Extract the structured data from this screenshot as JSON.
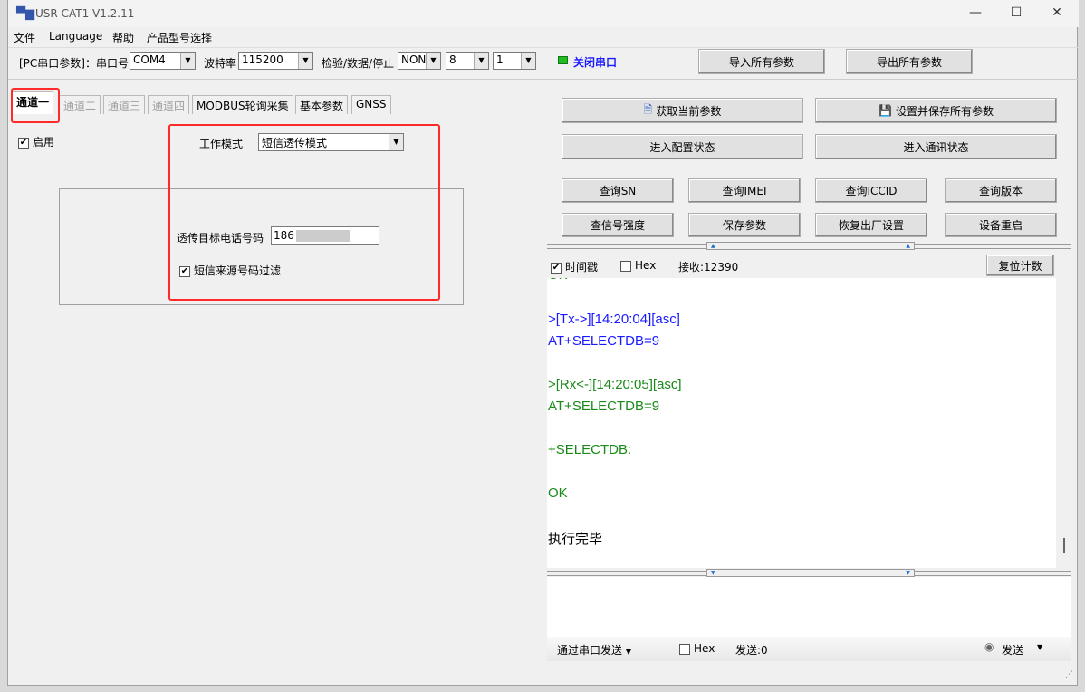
{
  "window": {
    "title": "USR-CAT1 V1.2.11",
    "min": "—",
    "max": "☐",
    "close": "✕"
  },
  "menu": [
    "文件",
    "Language",
    "帮助",
    "产品型号选择"
  ],
  "toolbar": {
    "pc_label": "[PC串口参数]：串口号",
    "port": "COM4",
    "baud_label": "波特率",
    "baud": "115200",
    "parity_label": "检验/数据/停止",
    "parity": "NONE",
    "data_bits": "8",
    "stop_bits": "1",
    "close_port": "关闭串口",
    "status_color": "#22bb22",
    "import": "导入所有参数",
    "export": "导出所有参数"
  },
  "tabs": [
    {
      "label": "通道一",
      "active": true
    },
    {
      "label": "通道二",
      "disabled": true
    },
    {
      "label": "通道三",
      "disabled": true
    },
    {
      "label": "通道四",
      "disabled": true
    },
    {
      "label": "MODBUS轮询采集"
    },
    {
      "label": "基本参数"
    },
    {
      "label": "GNSS"
    }
  ],
  "channel": {
    "enable_label": "启用",
    "enabled": true,
    "mode_label": "工作模式",
    "mode": "短信透传模式",
    "phone_label": "透传目标电话号码",
    "phone": "186",
    "filter_label": "短信来源号码过滤",
    "filter": true
  },
  "right": {
    "get_params": "获取当前参数",
    "save_all": "设置并保存所有参数",
    "enter_config": "进入配置状态",
    "enter_comm": "进入通讯状态",
    "small_buttons": [
      "查询SN",
      "查询IMEI",
      "查询ICCID",
      "查询版本",
      "查信号强度",
      "保存参数",
      "恢复出厂设置",
      "设备重启"
    ]
  },
  "recv": {
    "timestamp_label": "时间戳",
    "timestamp": true,
    "hex_label": "Hex",
    "hex": false,
    "count": "接收:12390",
    "reset": "复位计数"
  },
  "log": [
    {
      "text": "OK",
      "color": "green"
    },
    {
      "text": ">[Tx->][14:20:04][asc]",
      "color": "blue"
    },
    {
      "text": "AT+SELECTDB=9",
      "color": "blue"
    },
    {
      "text": ">[Rx<-][14:20:05][asc]",
      "color": "green"
    },
    {
      "text": "AT+SELECTDB=9",
      "color": "green"
    },
    {
      "text": "+SELECTDB:",
      "color": "green"
    },
    {
      "text": "OK",
      "color": "green"
    },
    {
      "text": "执行完毕",
      "color": "black"
    }
  ],
  "send": {
    "via": "通过串口发送",
    "hex_label": "Hex",
    "count": "发送:0",
    "send": "发送"
  },
  "colors": {
    "highlight": "#ff2a2a",
    "tx": "#1a1aff",
    "rx": "#1a8a1a"
  }
}
